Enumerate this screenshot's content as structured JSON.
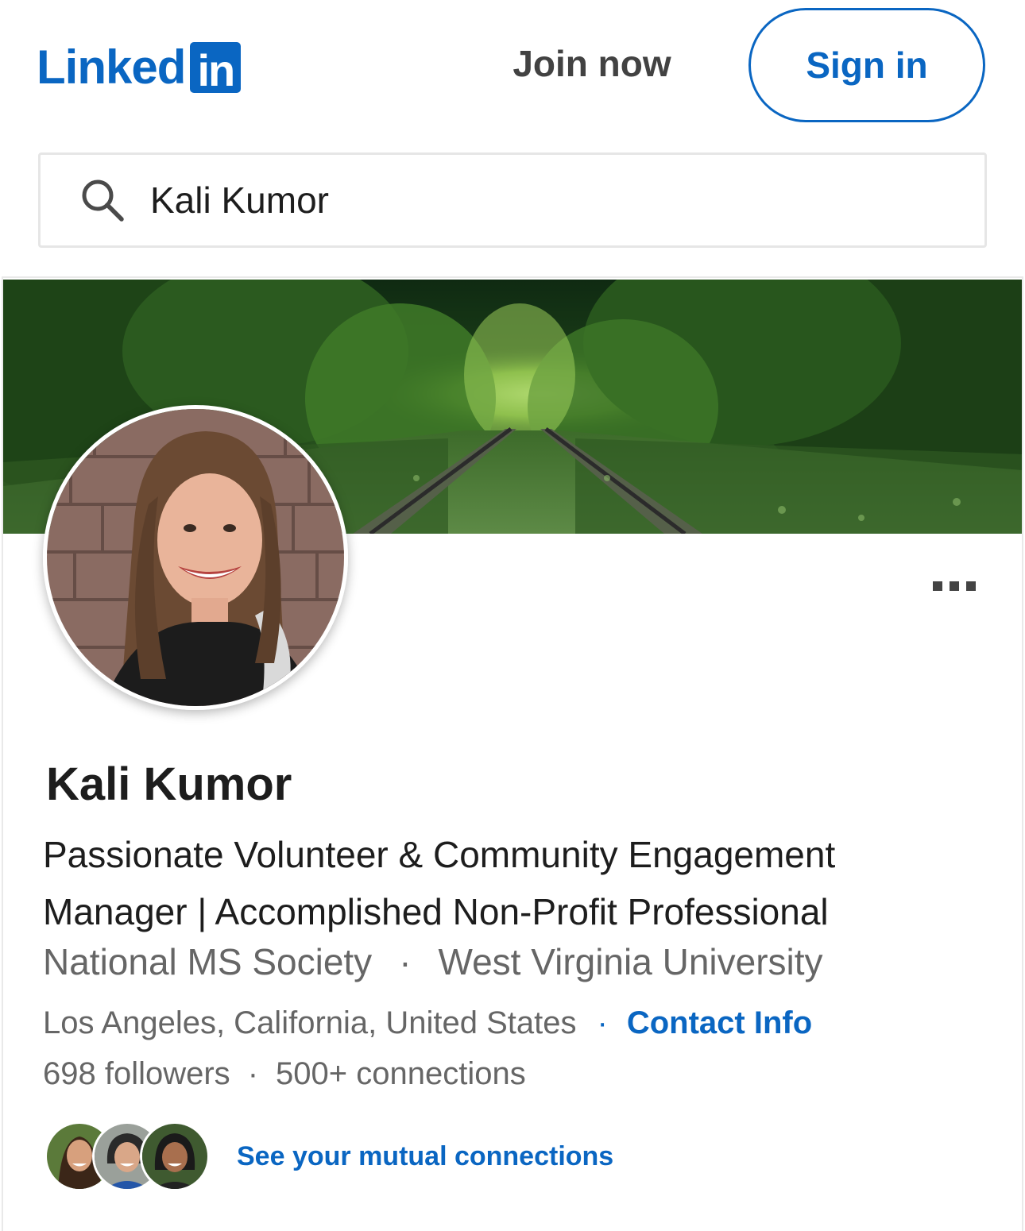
{
  "header": {
    "logo_word": "Linked",
    "logo_box": "in",
    "join_now": "Join now",
    "sign_in": "Sign in"
  },
  "search": {
    "value": "Kali Kumor",
    "icon": "search-icon"
  },
  "profile": {
    "name": "Kali Kumor",
    "headline": "Passionate Volunteer & Community Engagement Manager | Accomplished Non-Profit Professional",
    "employer": "National MS Society",
    "school": "West Virginia University",
    "location": "Los Angeles, California, United States",
    "contact_info": "Contact Info",
    "followers": "698 followers",
    "connections": "500+ connections",
    "mutual_connections": "See your mutual connections",
    "separator": "·"
  },
  "colors": {
    "brand": "#0a66c2",
    "text": "#1d1d1d",
    "muted": "#666666"
  }
}
